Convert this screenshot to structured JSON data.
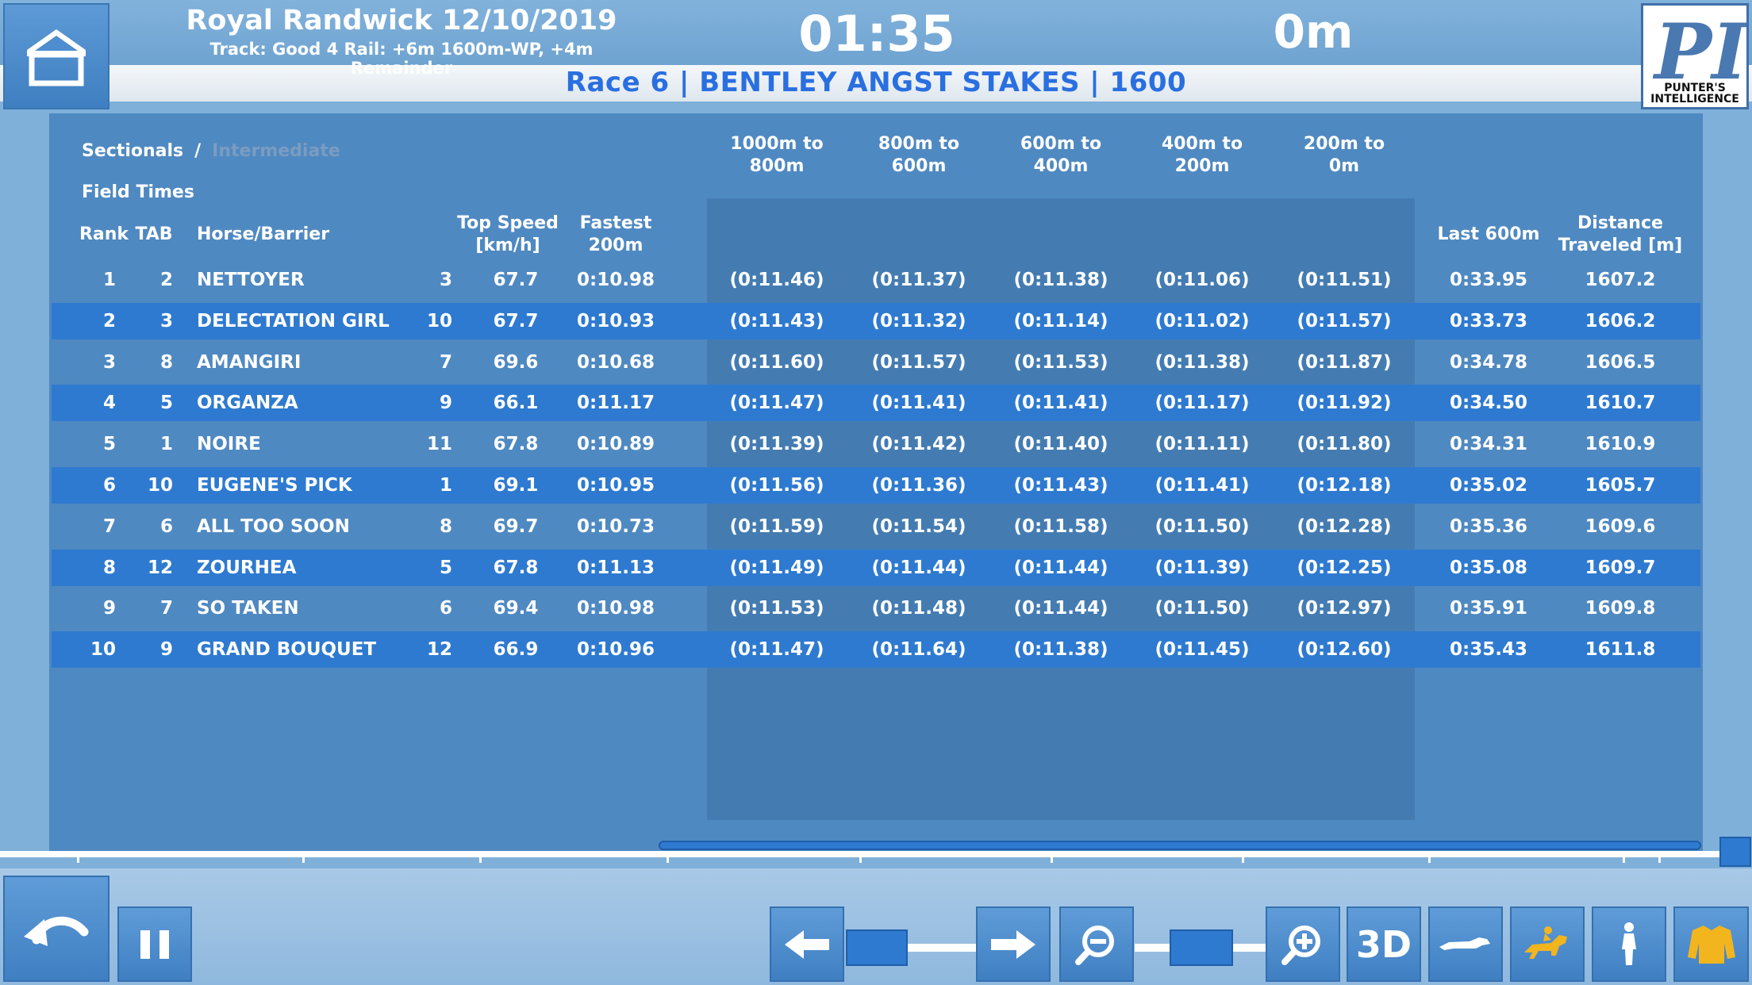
{
  "header": {
    "venue": "Royal Randwick 12/10/2019",
    "track_info": "Track: Good 4 Rail: +6m 1600m-WP, +4m Remainder",
    "clock": "01:35",
    "distance": "0m",
    "race_title": "Race 6 | BENTLEY ANGST STAKES | 1600",
    "logo_text_line1": "PUNTER'S",
    "logo_text_line2": "INTELLIGENCE",
    "logo_mark": "PI"
  },
  "breadcrumbs": {
    "sectionals": "Sectionals",
    "separator": "/",
    "intermediate": "Intermediate"
  },
  "field_times_label": "Field Times",
  "columns": {
    "rank": "Rank",
    "tab": "TAB",
    "horse": "Horse/Barrier",
    "top_speed_1": "Top Speed",
    "top_speed_2": "[km/h]",
    "fastest_1": "Fastest",
    "fastest_2": "200m",
    "s1_1": "1000m to",
    "s1_2": "800m",
    "s2_1": "800m to",
    "s2_2": "600m",
    "s3_1": "600m to",
    "s3_2": "400m",
    "s4_1": "400m to",
    "s4_2": "200m",
    "s5_1": "200m to",
    "s5_2": "0m",
    "last600": "Last 600m",
    "dist_1": "Distance",
    "dist_2": "Traveled [m]"
  },
  "rows": [
    {
      "rank": "1",
      "tab": "2",
      "horse": "NETTOYER",
      "barrier": "3",
      "speed": "67.7",
      "fastest": "0:10.98",
      "s1": "(0:11.46)",
      "s2": "(0:11.37)",
      "s3": "(0:11.38)",
      "s4": "(0:11.06)",
      "s5": "(0:11.51)",
      "last600": "0:33.95",
      "dist": "1607.2"
    },
    {
      "rank": "2",
      "tab": "3",
      "horse": "DELECTATION GIRL",
      "barrier": "10",
      "speed": "67.7",
      "fastest": "0:10.93",
      "s1": "(0:11.43)",
      "s2": "(0:11.32)",
      "s3": "(0:11.14)",
      "s4": "(0:11.02)",
      "s5": "(0:11.57)",
      "last600": "0:33.73",
      "dist": "1606.2"
    },
    {
      "rank": "3",
      "tab": "8",
      "horse": "AMANGIRI",
      "barrier": "7",
      "speed": "69.6",
      "fastest": "0:10.68",
      "s1": "(0:11.60)",
      "s2": "(0:11.57)",
      "s3": "(0:11.53)",
      "s4": "(0:11.38)",
      "s5": "(0:11.87)",
      "last600": "0:34.78",
      "dist": "1606.5"
    },
    {
      "rank": "4",
      "tab": "5",
      "horse": "ORGANZA",
      "barrier": "9",
      "speed": "66.1",
      "fastest": "0:11.17",
      "s1": "(0:11.47)",
      "s2": "(0:11.41)",
      "s3": "(0:11.41)",
      "s4": "(0:11.17)",
      "s5": "(0:11.92)",
      "last600": "0:34.50",
      "dist": "1610.7"
    },
    {
      "rank": "5",
      "tab": "1",
      "horse": "NOIRE",
      "barrier": "11",
      "speed": "67.8",
      "fastest": "0:10.89",
      "s1": "(0:11.39)",
      "s2": "(0:11.42)",
      "s3": "(0:11.40)",
      "s4": "(0:11.11)",
      "s5": "(0:11.80)",
      "last600": "0:34.31",
      "dist": "1610.9"
    },
    {
      "rank": "6",
      "tab": "10",
      "horse": "EUGENE'S PICK",
      "barrier": "1",
      "speed": "69.1",
      "fastest": "0:10.95",
      "s1": "(0:11.56)",
      "s2": "(0:11.36)",
      "s3": "(0:11.43)",
      "s4": "(0:11.41)",
      "s5": "(0:12.18)",
      "last600": "0:35.02",
      "dist": "1605.7"
    },
    {
      "rank": "7",
      "tab": "6",
      "horse": "ALL TOO SOON",
      "barrier": "8",
      "speed": "69.7",
      "fastest": "0:10.73",
      "s1": "(0:11.59)",
      "s2": "(0:11.54)",
      "s3": "(0:11.58)",
      "s4": "(0:11.50)",
      "s5": "(0:12.28)",
      "last600": "0:35.36",
      "dist": "1609.6"
    },
    {
      "rank": "8",
      "tab": "12",
      "horse": "ZOURHEA",
      "barrier": "5",
      "speed": "67.8",
      "fastest": "0:11.13",
      "s1": "(0:11.49)",
      "s2": "(0:11.44)",
      "s3": "(0:11.44)",
      "s4": "(0:11.39)",
      "s5": "(0:12.25)",
      "last600": "0:35.08",
      "dist": "1609.7"
    },
    {
      "rank": "9",
      "tab": "7",
      "horse": "SO TAKEN",
      "barrier": "6",
      "speed": "69.4",
      "fastest": "0:10.98",
      "s1": "(0:11.53)",
      "s2": "(0:11.48)",
      "s3": "(0:11.44)",
      "s4": "(0:11.50)",
      "s5": "(0:12.97)",
      "last600": "0:35.91",
      "dist": "1609.8"
    },
    {
      "rank": "10",
      "tab": "9",
      "horse": "GRAND BOUQUET",
      "barrier": "12",
      "speed": "66.9",
      "fastest": "0:10.96",
      "s1": "(0:11.47)",
      "s2": "(0:11.64)",
      "s3": "(0:11.38)",
      "s4": "(0:11.45)",
      "s5": "(0:12.60)",
      "last600": "0:35.43",
      "dist": "1611.8"
    }
  ],
  "controls": {
    "view_3d_label": "3D",
    "icons": [
      "home-icon",
      "back-icon",
      "pause-icon",
      "arrow-left-icon",
      "arrow-right-icon",
      "zoom-out-icon",
      "zoom-in-icon",
      "side-view-icon",
      "jockey-view-icon",
      "rider-view-icon",
      "silks-icon"
    ]
  },
  "colors": {
    "accent": "#2e7ad0",
    "race_title": "#2a6fe0",
    "panel": "#4f89c1",
    "silks": "#f2b51e"
  }
}
